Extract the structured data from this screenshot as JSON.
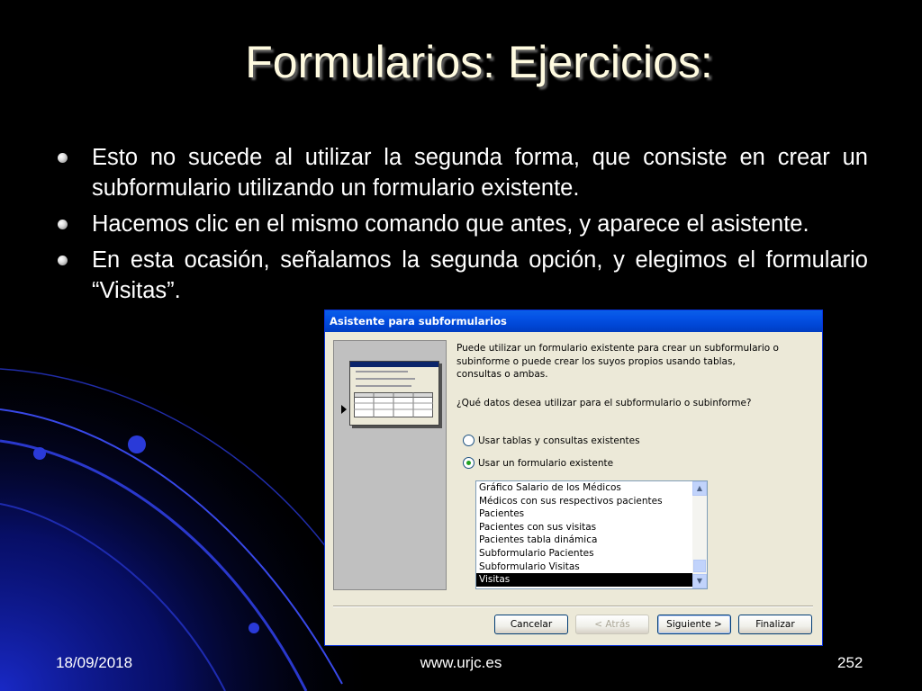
{
  "slide": {
    "title": "Formularios: Ejercicios:",
    "bullets": [
      "Esto no sucede al utilizar la segunda forma, que consiste en crear un subformulario utilizando un formulario existente.",
      "Hacemos clic en el mismo comando que antes, y aparece el asistente.",
      "En esta ocasión, señalamos la segunda opción, y elegimos el formulario “Visitas”."
    ],
    "footer": {
      "date": "18/09/2018",
      "url": "www.urjc.es",
      "page": "252"
    }
  },
  "dialog": {
    "title": "Asistente para subformularios",
    "intro": "Puede utilizar un formulario existente para crear un subformulario o subinforme o puede crear los suyos propios usando tablas, consultas o ambas.",
    "question": "¿Qué datos desea utilizar para el subformulario o subinforme?",
    "options": [
      {
        "label": "Usar tablas y consultas existentes",
        "selected": false
      },
      {
        "label": "Usar un formulario existente",
        "selected": true
      }
    ],
    "forms": [
      "Gráfico Salario de los Médicos",
      "Médicos con sus respectivos pacientes",
      "Pacientes",
      "Pacientes con sus visitas",
      "Pacientes tabla dinámica",
      "Subformulario Pacientes",
      "Subformulario Visitas",
      "Visitas"
    ],
    "selected_form": "Visitas",
    "buttons": {
      "cancel": "Cancelar",
      "back": "< Atrás",
      "next": "Siguiente >",
      "finish": "Finalizar"
    }
  },
  "colors": {
    "background": "#000000",
    "title_text": "#fffbe0",
    "dialog_titlebar": "#0054e3",
    "dialog_body": "#ece9d8",
    "list_selection": "#000000"
  }
}
